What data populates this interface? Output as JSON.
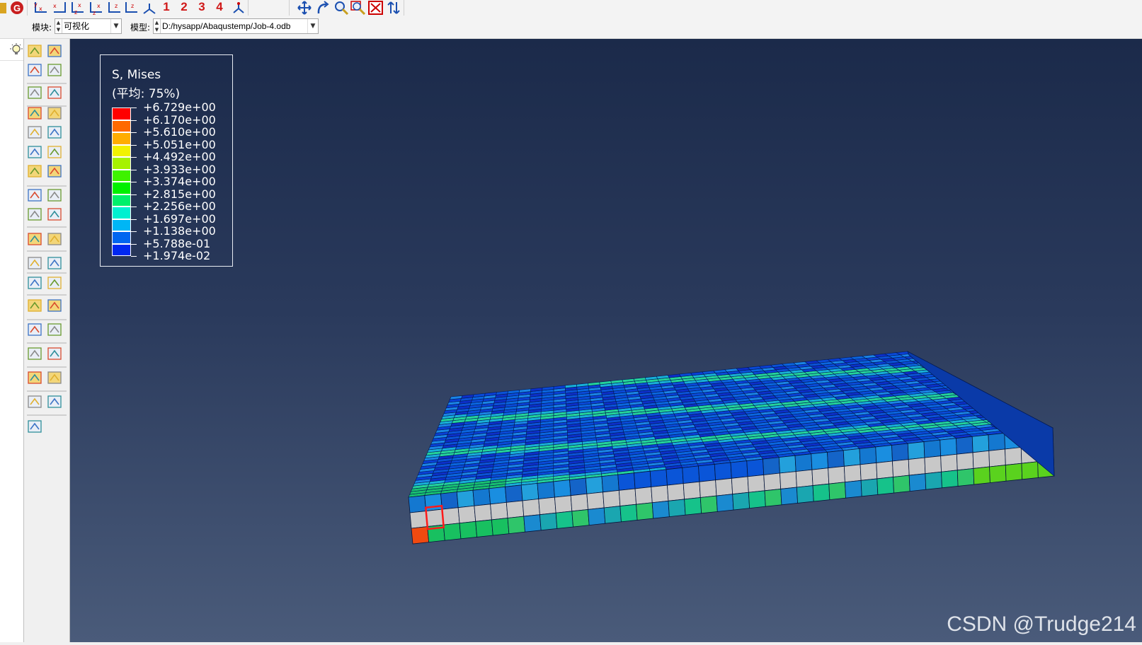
{
  "toolbar": {
    "view_numbers": [
      "1",
      "2",
      "3",
      "4"
    ],
    "icons": [
      "app-icon",
      "g-logo-icon",
      "view-xy-icon",
      "view-yx-icon",
      "view-zy-icon",
      "view-yz-icon",
      "view-zx-icon",
      "view-xz-icon",
      "iso-view-icon",
      "pan-icon",
      "rotate-icon",
      "zoom-icon",
      "box-zoom-icon",
      "auto-fit-icon",
      "cycle-icon"
    ]
  },
  "context_bar": {
    "module_label": "模块:",
    "module_value": "可视化",
    "model_label": "模型:",
    "model_value": "D:/hysapp/Abaqustemp/Job-4.odb"
  },
  "legend": {
    "title": "S, Mises",
    "subtitle": "(平均: 75%)",
    "values": [
      "+6.729e+00",
      "+6.170e+00",
      "+5.610e+00",
      "+5.051e+00",
      "+4.492e+00",
      "+3.933e+00",
      "+3.374e+00",
      "+2.815e+00",
      "+2.256e+00",
      "+1.697e+00",
      "+1.138e+00",
      "+5.788e-01",
      "+1.974e-02"
    ],
    "colors": [
      "#ff0000",
      "#ff6a00",
      "#ffad00",
      "#f2f200",
      "#a6f200",
      "#3ef200",
      "#00f000",
      "#00f06a",
      "#00f0d0",
      "#00b6f5",
      "#0066f0",
      "#0028f0"
    ]
  },
  "watermark": "CSDN @Trudge214"
}
